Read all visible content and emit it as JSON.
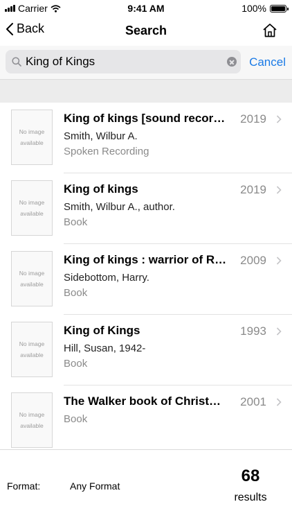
{
  "status_bar": {
    "carrier": "Carrier",
    "time": "9:41 AM",
    "battery": "100%"
  },
  "nav": {
    "back_label": "Back",
    "title": "Search"
  },
  "search": {
    "value": "King of Kings",
    "cancel_label": "Cancel"
  },
  "no_image_text": "No image available",
  "results": [
    {
      "title": "King of kings [sound recording]",
      "year": "2019",
      "author": "Smith, Wilbur A.",
      "format": "Spoken Recording"
    },
    {
      "title": "King of kings",
      "year": "2019",
      "author": "Smith, Wilbur A., author.",
      "format": "Book"
    },
    {
      "title": "King of kings : warrior of Rome",
      "year": "2009",
      "author": "Sidebottom, Harry.",
      "format": "Book"
    },
    {
      "title": "King of Kings",
      "year": "1993",
      "author": "Hill, Susan, 1942-",
      "format": "Book"
    },
    {
      "title": "The Walker book of Christmas",
      "year": "2001",
      "author": "",
      "format": "Book"
    }
  ],
  "footer": {
    "format_label": "Format:",
    "format_value": "Any Format",
    "count": "68",
    "count_label": "results"
  },
  "colors": {
    "accent": "#1a7ae6",
    "secondary_text": "#8a8a8a"
  },
  "icons": {
    "back": "chevron-left-icon",
    "home": "home-icon",
    "search": "magnifier-icon",
    "clear": "clear-x-icon",
    "row": "chevron-right-icon"
  }
}
